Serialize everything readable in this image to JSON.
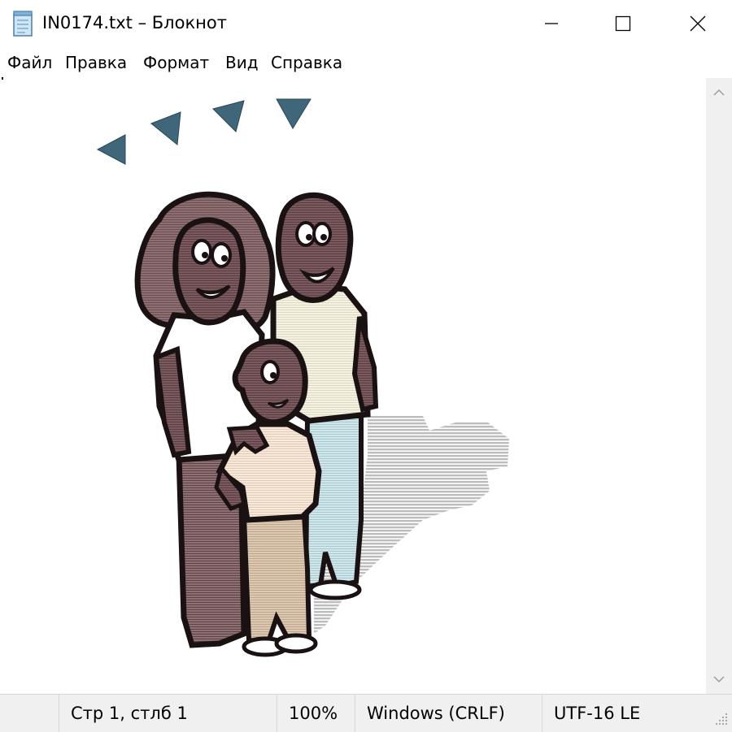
{
  "window": {
    "title": "IN0174.txt – Блокнот",
    "controls": [
      "minimize",
      "maximize",
      "close"
    ]
  },
  "menu": {
    "items": [
      "Файл",
      "Правка",
      "Формат",
      "Вид",
      "Справка"
    ]
  },
  "editor": {
    "content_description_icon": "family-ascii-art",
    "colors": {
      "outline": "#1a1212",
      "skin": "#6e4f53",
      "shirt_man": "#f3f0de",
      "shirt_boy": "#f6e6d6",
      "pants_man": "#c9e2e6",
      "pants_boy": "#d9c4ae",
      "shadow": "#c8c8c8",
      "arrows": "#3f6679"
    }
  },
  "status": {
    "position": "Стр 1, стлб 1",
    "zoom": "100%",
    "line_endings": "Windows (CRLF)",
    "encoding": "UTF-16 LE"
  }
}
